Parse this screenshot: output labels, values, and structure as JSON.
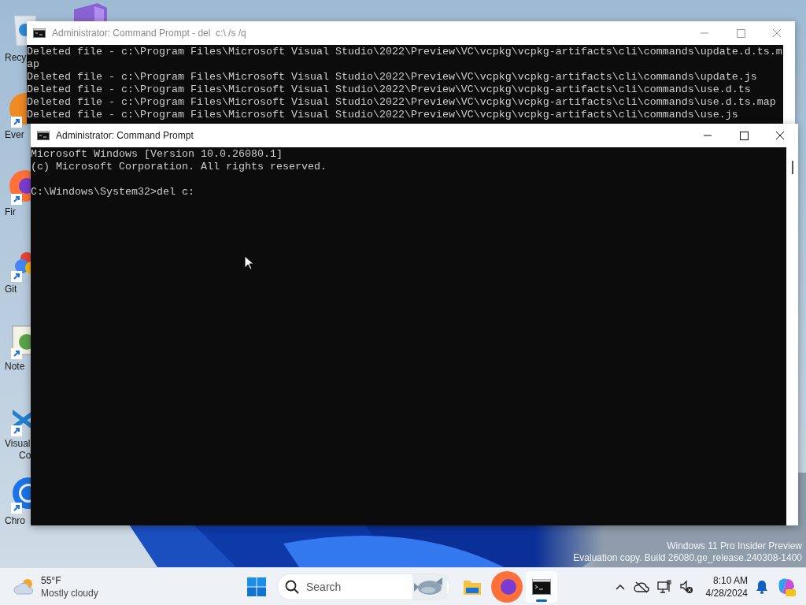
{
  "desktop": {
    "icons": [
      {
        "kind": "recycle-bin",
        "label": "Recy"
      },
      {
        "kind": "round-app",
        "label": "Ever"
      },
      {
        "kind": "firefox",
        "label": "Fir"
      },
      {
        "kind": "git",
        "label": "Git"
      },
      {
        "kind": "notepad",
        "label": "Note"
      },
      {
        "kind": "vscode",
        "label": "Visual",
        "label_2": "Co"
      },
      {
        "kind": "chrome",
        "label": "Chro"
      }
    ],
    "second_column_icons": [
      {
        "kind": "visual-studio"
      }
    ],
    "watermark": [
      "Windows 11 Pro Insider Preview",
      "Evaluation copy. Build 26080.ge_release.240308-1400"
    ]
  },
  "windows": [
    {
      "title": "Administrator: Command Prompt - del  c:\\ /s /q",
      "active": false,
      "lines": [
        "Deleted file - c:\\Program Files\\Microsoft Visual Studio\\2022\\Preview\\VC\\vcpkg\\vcpkg-artifacts\\cli\\commands\\update.d.ts.m",
        "ap",
        "Deleted file - c:\\Program Files\\Microsoft Visual Studio\\2022\\Preview\\VC\\vcpkg\\vcpkg-artifacts\\cli\\commands\\update.js",
        "Deleted file - c:\\Program Files\\Microsoft Visual Studio\\2022\\Preview\\VC\\vcpkg\\vcpkg-artifacts\\cli\\commands\\use.d.ts",
        "Deleted file - c:\\Program Files\\Microsoft Visual Studio\\2022\\Preview\\VC\\vcpkg\\vcpkg-artifacts\\cli\\commands\\use.d.ts.map",
        "Deleted file - c:\\Program Files\\Microsoft Visual Studio\\2022\\Preview\\VC\\vcpkg\\vcpkg-artifacts\\cli\\commands\\use.js"
      ]
    },
    {
      "title": "Administrator: Command Prompt",
      "active": true,
      "lines": [
        "Microsoft Windows [Version 10.0.26080.1]",
        "(c) Microsoft Corporation. All rights reserved."
      ],
      "prompt": "C:\\Windows\\System32>del c:"
    }
  ],
  "taskbar": {
    "weather": {
      "temperature": "55°F",
      "condition": "Mostly cloudy"
    },
    "search": {
      "placeholder": "Search"
    },
    "apps": [
      {
        "kind": "file-explorer",
        "selected": false
      },
      {
        "kind": "firefox",
        "selected": false
      },
      {
        "kind": "terminal",
        "selected": true
      }
    ],
    "clock": {
      "time": "8:10 AM",
      "date": "4/28/2024"
    }
  }
}
